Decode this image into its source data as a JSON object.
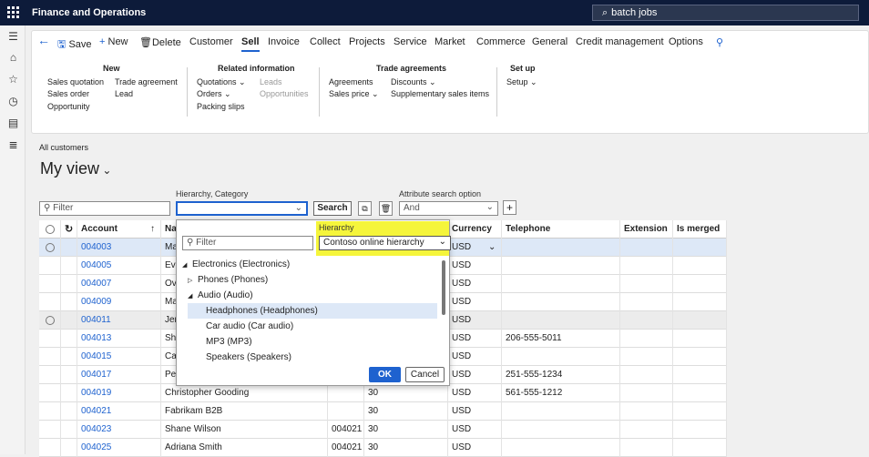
{
  "app": {
    "title": "Finance and Operations",
    "search": "batch jobs"
  },
  "toolbar": {
    "save": "Save",
    "new": "New",
    "delete": "Delete",
    "tabs": [
      "Customer",
      "Sell",
      "Invoice",
      "Collect",
      "Projects",
      "Service",
      "Market",
      "Commerce",
      "General",
      "Credit management",
      "Options"
    ]
  },
  "groups": {
    "new": {
      "title": "New",
      "items": [
        "Sales quotation",
        "Sales order",
        "Opportunity",
        "Trade agreement",
        "Lead"
      ]
    },
    "related": {
      "title": "Related information",
      "items": [
        "Quotations",
        "Orders",
        "Packing slips",
        "Leads",
        "Opportunities"
      ]
    },
    "trade": {
      "title": "Trade agreements",
      "items": [
        "Agreements",
        "Sales price",
        "Discounts",
        "Supplementary sales items"
      ]
    },
    "setup": {
      "title": "Set up",
      "items": [
        "Setup"
      ]
    }
  },
  "page": {
    "breadcrumb": "All customers",
    "view_title": "My view"
  },
  "filters": {
    "filter_placeholder": "Filter",
    "hierarchy_label": "Hierarchy, Category",
    "search_button": "Search",
    "attr_label": "Attribute search option",
    "attr_value": "And"
  },
  "grid": {
    "headers": [
      "Account",
      "Na",
      "Currency",
      "Telephone",
      "Extension",
      "Is merged"
    ],
    "rows": [
      {
        "account": "004003",
        "name": "Ma",
        "group": "",
        "terms": "",
        "currency": "USD",
        "phone": ""
      },
      {
        "account": "004005",
        "name": "Ev",
        "group": "",
        "terms": "",
        "currency": "USD",
        "phone": ""
      },
      {
        "account": "004007",
        "name": "Ov",
        "group": "",
        "terms": "",
        "currency": "USD",
        "phone": ""
      },
      {
        "account": "004009",
        "name": "Ma",
        "group": "",
        "terms": "",
        "currency": "USD",
        "phone": ""
      },
      {
        "account": "004011",
        "name": "Jer",
        "group": "",
        "terms": "",
        "currency": "USD",
        "phone": ""
      },
      {
        "account": "004013",
        "name": "Sh",
        "group": "",
        "terms": "",
        "currency": "USD",
        "phone": "206-555-5011"
      },
      {
        "account": "004015",
        "name": "Ca",
        "group": "",
        "terms": "",
        "currency": "USD",
        "phone": ""
      },
      {
        "account": "004017",
        "name": "Pe",
        "group": "",
        "terms": "",
        "currency": "USD",
        "phone": "251-555-1234"
      },
      {
        "account": "004019",
        "name": "Christopher Gooding",
        "group": "",
        "terms": "30",
        "currency": "USD",
        "phone": "561-555-1212"
      },
      {
        "account": "004021",
        "name": "Fabrikam B2B",
        "group": "",
        "terms": "30",
        "currency": "USD",
        "phone": ""
      },
      {
        "account": "004023",
        "name": "Shane Wilson",
        "group": "004021",
        "terms": "30",
        "currency": "USD",
        "phone": ""
      },
      {
        "account": "004025",
        "name": "Adriana Smith",
        "group": "004021",
        "terms": "30",
        "currency": "USD",
        "phone": ""
      }
    ]
  },
  "popup": {
    "filter_placeholder": "Filter",
    "hierarchy_label": "Hierarchy",
    "hierarchy_value": "Contoso online hierarchy",
    "tree": [
      "Electronics (Electronics)",
      "Phones (Phones)",
      "Audio (Audio)",
      "Headphones (Headphones)",
      "Car audio (Car audio)",
      "MP3 (MP3)",
      "Speakers (Speakers)"
    ],
    "ok": "OK",
    "cancel": "Cancel"
  },
  "colors": {
    "topbar": "#0d1b3a",
    "accent": "#1e62cf",
    "highlight": "#f5f53b"
  }
}
